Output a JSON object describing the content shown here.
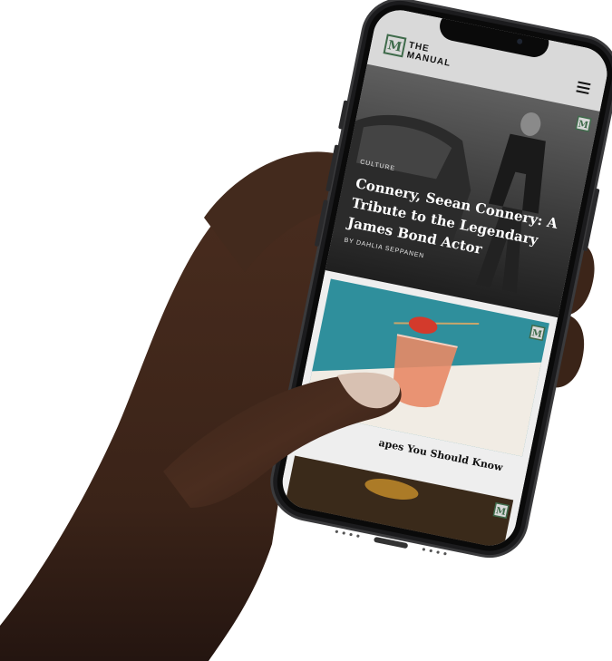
{
  "site": {
    "logo_letter": "M",
    "name_line1": "THE",
    "name_line2": "MANUAL"
  },
  "hero": {
    "category": "CULTURE",
    "title_line1": "Connery, Seean Connery: A",
    "title_line2": "Tribute to the Legendary",
    "title_line3": "James Bond Actor",
    "byline": "BY DAHLIA SEPPANEN"
  },
  "card": {
    "badge_letter": "M",
    "title_partial": "apes You Should Know"
  },
  "card_next": {
    "badge_letter": "M"
  },
  "colors": {
    "header_bg": "#d9d9d9",
    "logo_green": "#3f6b4b",
    "card_teal": "#2f8f9c",
    "drink": "#e88a66"
  },
  "icons": {
    "menu": "hamburger-menu-icon",
    "logo": "m-logo-icon"
  }
}
